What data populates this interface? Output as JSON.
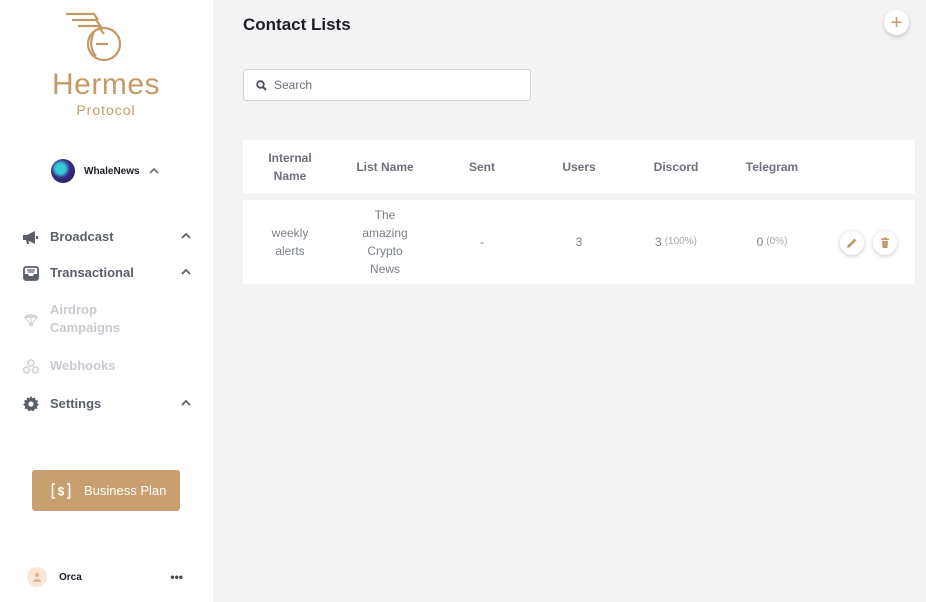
{
  "brand": {
    "title": "Hermes",
    "subtitle": "Protocol",
    "accent": "#c49a66"
  },
  "account": {
    "name": "WhaleNews"
  },
  "nav": [
    {
      "label": "Broadcast",
      "icon": "megaphone-icon",
      "enabled": true
    },
    {
      "label": "Transactional",
      "icon": "inbox-icon",
      "enabled": true
    },
    {
      "label": "Airdrop Campaigns",
      "icon": "parachute-icon",
      "enabled": false
    },
    {
      "label": "Webhooks",
      "icon": "webhook-icon",
      "enabled": false
    },
    {
      "label": "Settings",
      "icon": "gear-icon",
      "enabled": true
    }
  ],
  "business_plan": {
    "label": "Business Plan"
  },
  "user": {
    "name": "Orca",
    "more": "•••"
  },
  "page": {
    "title": "Contact Lists",
    "add": "+"
  },
  "search": {
    "placeholder": "Search",
    "value": ""
  },
  "table": {
    "columns": [
      "Internal Name",
      "List Name",
      "Sent",
      "Users",
      "Discord",
      "Telegram"
    ],
    "rows": [
      {
        "internal_name": "weekly alerts",
        "list_name": "The amazing Crypto News",
        "sent": "-",
        "users": "3",
        "discord": "3",
        "discord_pct": "(100%)",
        "telegram": "0",
        "telegram_pct": "(0%)"
      }
    ]
  }
}
